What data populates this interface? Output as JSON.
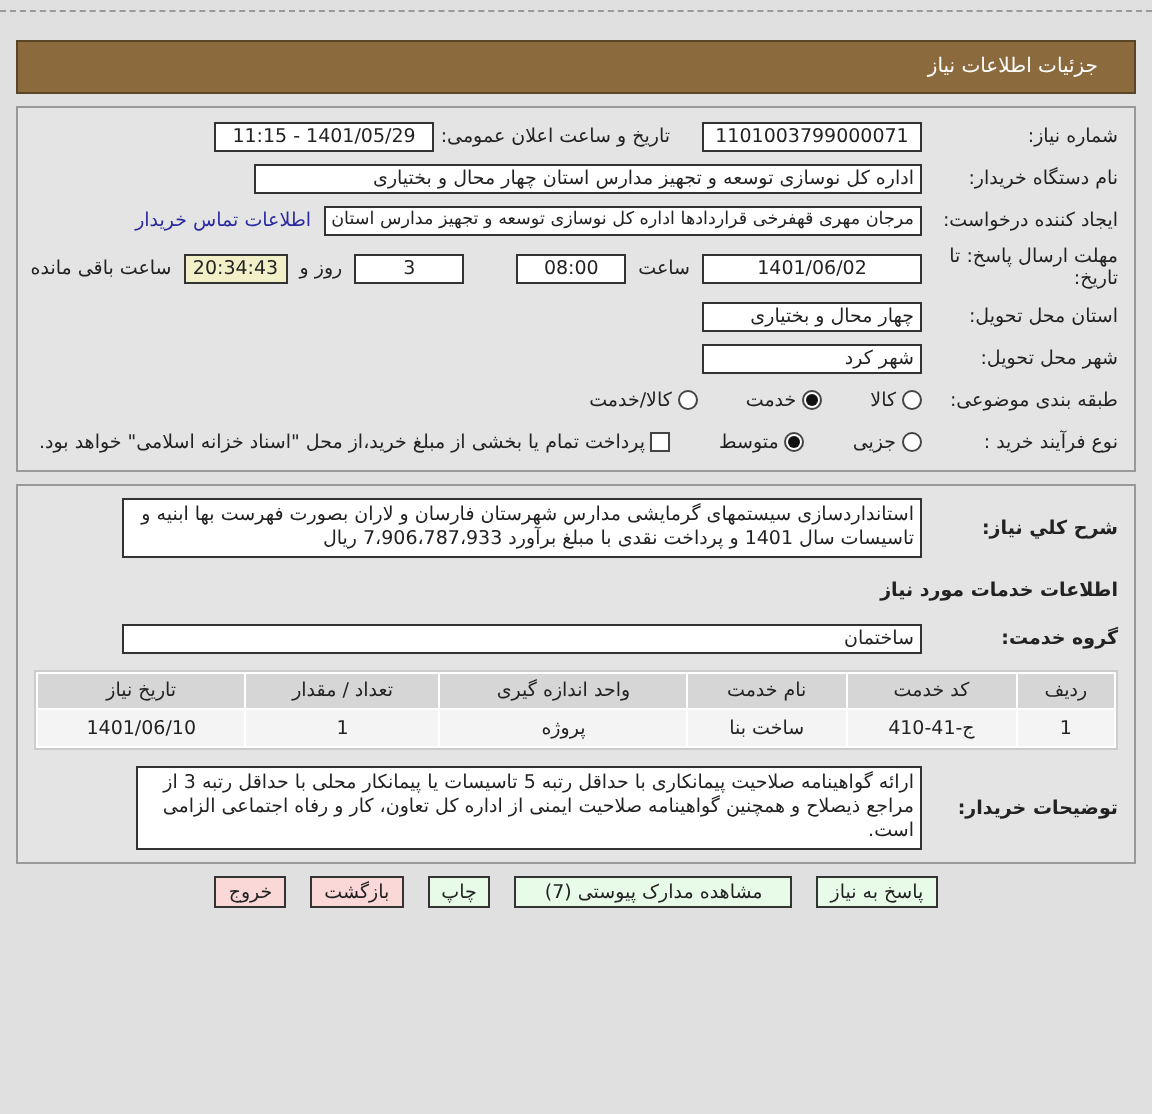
{
  "header": {
    "title": "جزئیات اطلاعات نیاز"
  },
  "info": {
    "need_number": {
      "label": "شماره نیاز:",
      "value": "1101003799000071"
    },
    "announce": {
      "label": "تاریخ و ساعت اعلان عمومی:",
      "value": "1401/05/29 - 11:15"
    },
    "buyer": {
      "label": "نام دستگاه خریدار:",
      "value": "اداره کل نوسازی  توسعه و تجهیز مدارس استان چهار محال و بختیاری"
    },
    "creator": {
      "label": "ایجاد کننده درخواست:",
      "value": "مرجان مهری قهفرخی قراردادها اداره کل نوسازی  توسعه و تجهیز مدارس استان",
      "link": "اطلاعات تماس خریدار"
    },
    "deadline": {
      "label": "مهلت ارسال پاسخ: تا تاریخ:",
      "date": "1401/06/02",
      "time_label": "ساعت",
      "time": "08:00",
      "days": "3",
      "days_label": "روز و",
      "remaining": "20:34:43",
      "remaining_label": "ساعت باقی مانده"
    },
    "province": {
      "label": "استان محل تحویل:",
      "value": "چهار محال و بختیاری"
    },
    "city": {
      "label": "شهر محل تحویل:",
      "value": "شهر کرد"
    },
    "category": {
      "label": "طبقه بندی موضوعی:",
      "options": [
        {
          "label": "کالا",
          "selected": false
        },
        {
          "label": "خدمت",
          "selected": true
        },
        {
          "label": "کالا/خدمت",
          "selected": false
        }
      ]
    },
    "process": {
      "label": "نوع فرآیند خرید :",
      "options": [
        {
          "label": "جزیی",
          "selected": false
        },
        {
          "label": "متوسط",
          "selected": true
        }
      ],
      "payment": {
        "label": "پرداخت تمام یا بخشی از مبلغ خرید،از محل \"اسناد خزانه اسلامی\" خواهد بود.",
        "checked": false
      }
    }
  },
  "details": {
    "description": {
      "label": "شرح کلي نياز:",
      "value": "استانداردسازی سیستمهای گرمایشی مدارس شهرستان فارسان و لاران بصورت فهرست بها ابنیه و تاسیسات سال 1401 و پرداخت نقدی با مبلغ برآورد 7،906،787،933 ریال"
    },
    "section_title": "اطلاعات خدمات مورد نیاز",
    "service_group": {
      "label": "گروه خدمت:",
      "value": "ساختمان"
    },
    "table": {
      "columns": [
        "ردیف",
        "کد خدمت",
        "نام خدمت",
        "واحد اندازه گیری",
        "تعداد / مقدار",
        "تاریخ نیاز"
      ],
      "rows": [
        [
          "1",
          "ج-41-410",
          "ساخت بنا",
          "پروژه",
          "1",
          "1401/06/10"
        ]
      ]
    },
    "notes": {
      "label": "توضیحات خریدار:",
      "value": "ارائه گواهینامه صلاحیت پیمانکاری با حداقل رتبه 5 تاسیسات یا پیمانکار محلی با حداقل رتبه 3 از مراجع ذیصلاح و همچنین گواهینامه صلاحیت ایمنی از اداره کل تعاون، کار و رفاه اجتماعی الزامی است."
    }
  },
  "buttons": [
    {
      "label": "پاسخ به نیاز",
      "kind": "action"
    },
    {
      "label": "مشاهده مدارک پیوستی (7)",
      "kind": "action"
    },
    {
      "label": "چاپ",
      "kind": "action"
    },
    {
      "label": "بازگشت",
      "kind": "exit"
    },
    {
      "label": "خروج",
      "kind": "exit"
    }
  ]
}
